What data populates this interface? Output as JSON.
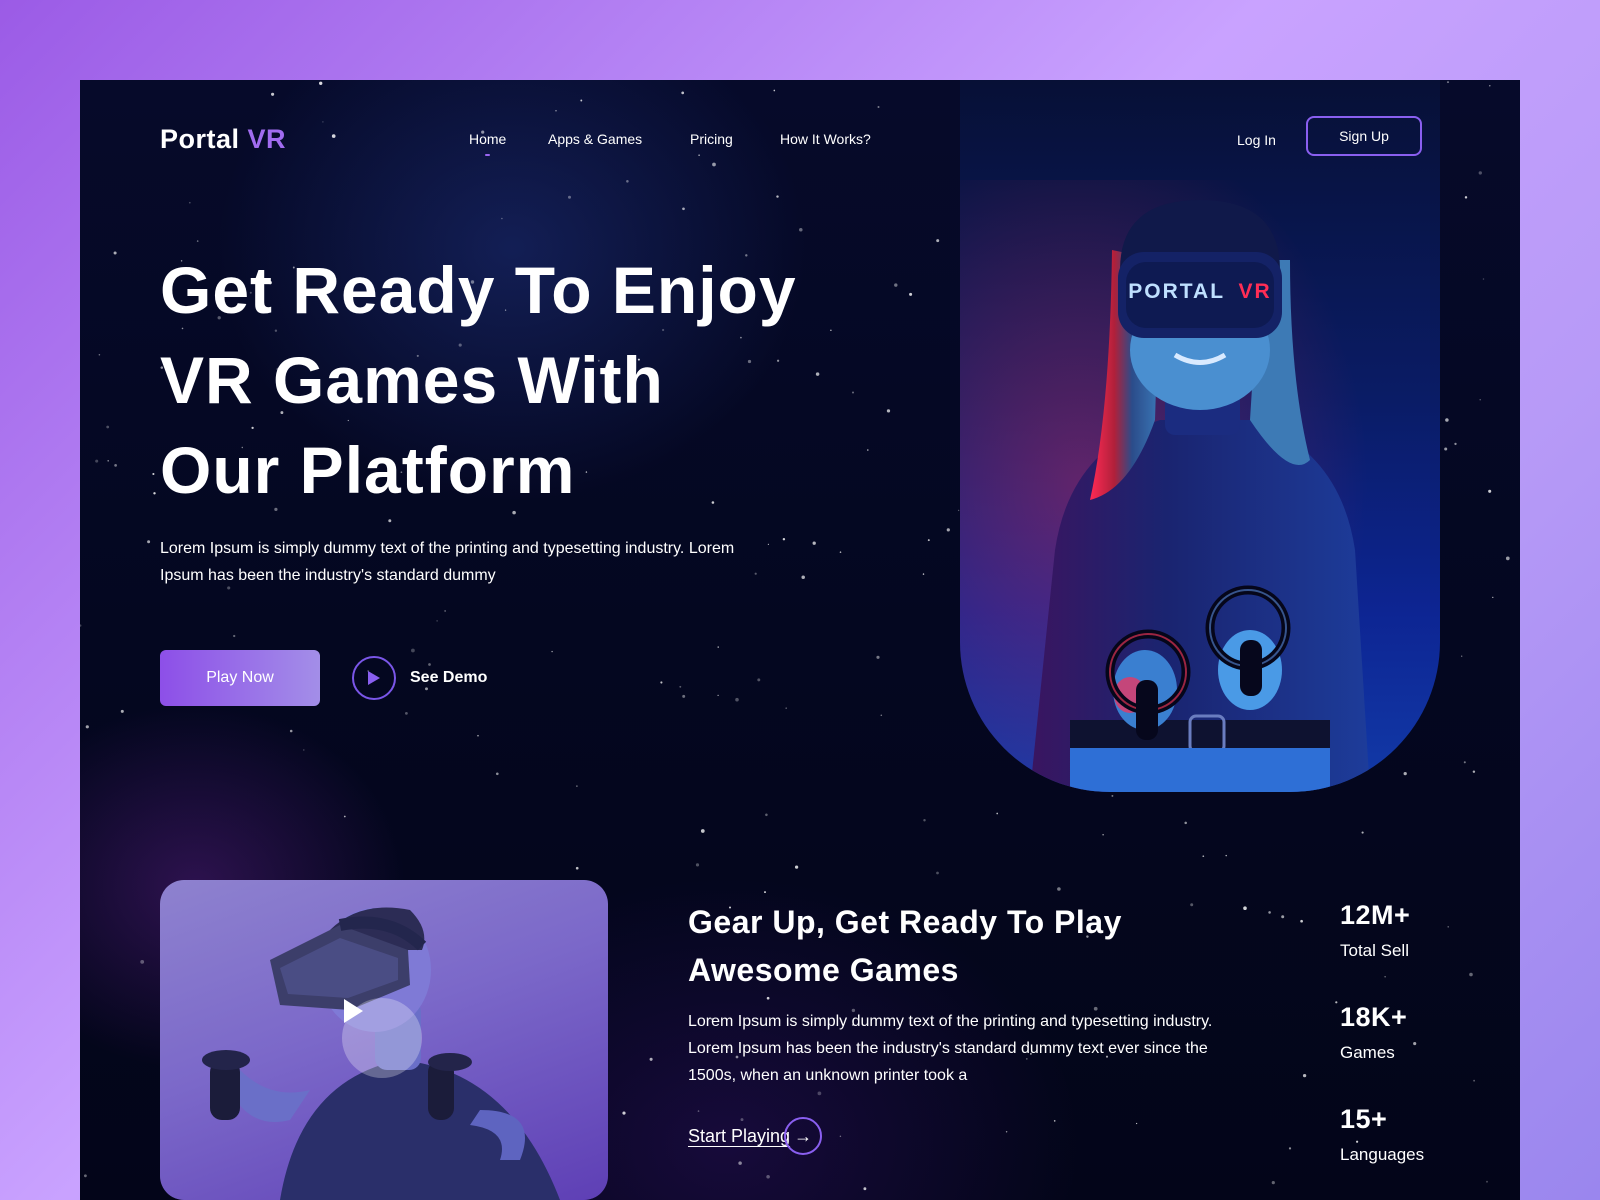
{
  "brand": {
    "name": "Portal",
    "accent": "VR"
  },
  "nav": {
    "items": [
      "Home",
      "Apps & Games",
      "Pricing",
      "How It Works?"
    ],
    "active": "Home"
  },
  "auth": {
    "login": "Log In",
    "signup": "Sign Up"
  },
  "hero": {
    "headline": [
      "Get Ready To Enjoy",
      "VR Games With",
      "Our Platform"
    ],
    "description": "Lorem Ipsum is simply dummy text of the printing and typesetting industry. Lorem Ipsum has been the industry's standard dummy",
    "play_now": "Play Now",
    "see_demo": "See Demo",
    "headset_text": "PORTAL",
    "headset_accent": "VR"
  },
  "section": {
    "title": [
      "Gear Up, Get Ready To Play",
      "Awesome Games"
    ],
    "description": "Lorem Ipsum is simply dummy text of the printing and typesetting industry. Lorem Ipsum has been the industry's standard dummy text ever since the 1500s, when an unknown printer took a",
    "cta": "Start Playing"
  },
  "stats": [
    {
      "value": "12M+",
      "label": "Total Sell"
    },
    {
      "value": "18K+",
      "label": "Games"
    },
    {
      "value": "15+",
      "label": "Languages"
    }
  ],
  "colors": {
    "accent": "#9a66f2",
    "page_bg": "#040720",
    "outer_bg": "#b58af5",
    "button_gradient_start": "#8d4fe8",
    "button_gradient_end": "#a38ee8"
  },
  "icons": {
    "demo": "play-icon",
    "video": "play-icon",
    "cta": "arrow-right-icon"
  }
}
